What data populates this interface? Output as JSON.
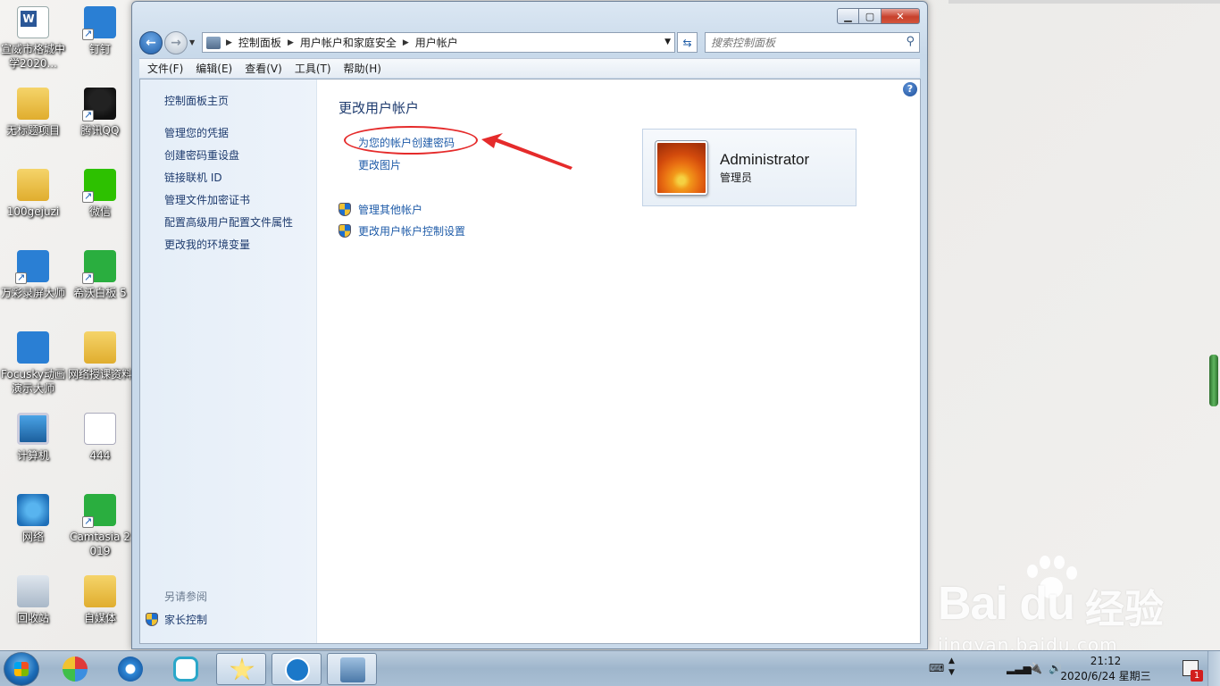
{
  "desktop": {
    "icons": [
      {
        "label": "宣威市格城中学2020...",
        "icon": "word-document-icon"
      },
      {
        "label": "钉钉",
        "icon": "dingtalk-icon"
      },
      {
        "label": "无标题项目",
        "icon": "folder-icon"
      },
      {
        "label": "腾讯QQ",
        "icon": "qq-icon"
      },
      {
        "label": "100gejuzi",
        "icon": "folder-icon"
      },
      {
        "label": "微信",
        "icon": "wechat-icon"
      },
      {
        "label": "万彩录屏大师",
        "icon": "screen-recorder-icon"
      },
      {
        "label": "希沃白板 5",
        "icon": "seewo-whiteboard-icon"
      },
      {
        "label": "Focusky动画演示大师",
        "icon": "focusky-icon"
      },
      {
        "label": "网络授课资料",
        "icon": "folder-icon"
      },
      {
        "label": "计算机",
        "icon": "computer-icon"
      },
      {
        "label": "444",
        "icon": "fs-file-icon"
      },
      {
        "label": "网络",
        "icon": "network-icon"
      },
      {
        "label": "Camtasia 2019",
        "icon": "camtasia-icon"
      },
      {
        "label": "回收站",
        "icon": "recycle-bin-icon"
      },
      {
        "label": "自媒体",
        "icon": "folder-icon"
      }
    ]
  },
  "window": {
    "address": {
      "crumbs": [
        "控制面板",
        "用户帐户和家庭安全",
        "用户帐户"
      ]
    },
    "search": {
      "placeholder": "搜索控制面板"
    },
    "menu": [
      "文件(F)",
      "编辑(E)",
      "查看(V)",
      "工具(T)",
      "帮助(H)"
    ],
    "left_pane": {
      "home": "控制面板主页",
      "links": [
        "管理您的凭据",
        "创建密码重设盘",
        "链接联机 ID",
        "管理文件加密证书",
        "配置高级用户配置文件属性",
        "更改我的环境变量"
      ],
      "see_also_title": "另请参阅",
      "see_also_link": "家长控制"
    },
    "main": {
      "title": "更改用户帐户",
      "create_password": "为您的帐户创建密码",
      "change_picture": "更改图片",
      "manage_other": "管理其他帐户",
      "uac_settings": "更改用户帐户控制设置"
    },
    "account": {
      "name": "Administrator",
      "role": "管理员"
    }
  },
  "taskbar": {
    "clock_time": "21:12",
    "clock_date": "2020/6/24 星期三",
    "notification_count": "1"
  },
  "watermark": {
    "logo": "Bai du",
    "cn": "经验",
    "url": "jingyan.baidu.com"
  },
  "colors": {
    "link": "#1e5ba8",
    "highlight": "#e52b2b"
  }
}
